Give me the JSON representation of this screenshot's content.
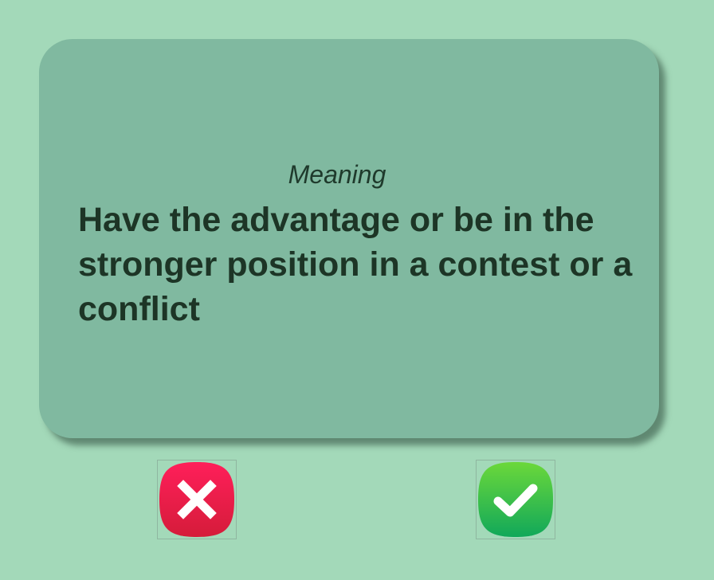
{
  "card": {
    "label": "Meaning",
    "text": "Have the advantage or be in the stronger position in a contest or a conflict"
  },
  "buttons": {
    "wrong": {
      "icon": "cross-icon",
      "color_top": "#ff1f5a",
      "color_bottom": "#d51c3a"
    },
    "right": {
      "icon": "check-icon",
      "color_top": "#6bd83a",
      "color_bottom": "#11a85a"
    }
  },
  "colors": {
    "background": "#a3d9b9",
    "card": "#80b9a0",
    "text": "#1d3526"
  }
}
